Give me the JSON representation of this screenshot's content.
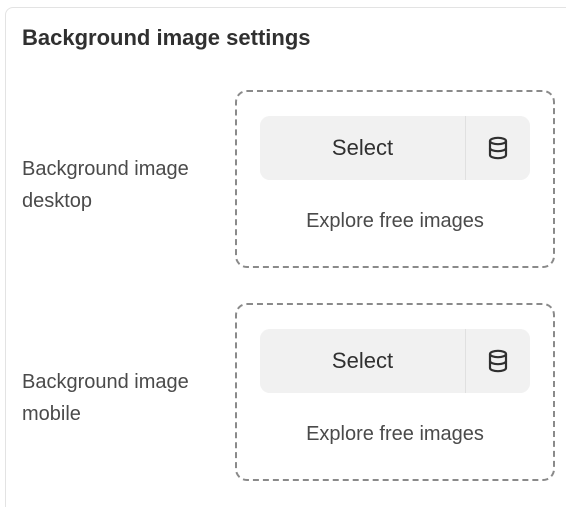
{
  "section": {
    "title": "Background image settings"
  },
  "settings": [
    {
      "label": "Background image desktop",
      "select_label": "Select",
      "source_icon": "database-icon",
      "explore_label": "Explore free images"
    },
    {
      "label": "Background image mobile",
      "select_label": "Select",
      "source_icon": "database-icon",
      "explore_label": "Explore free images"
    }
  ]
}
